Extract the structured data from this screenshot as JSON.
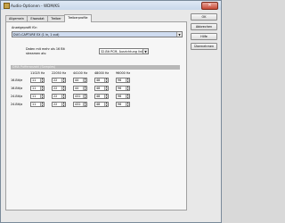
{
  "window": {
    "title": "Audio-Optionen - WDM/KS",
    "close_glyph": "✕"
  },
  "tabs": [
    {
      "label": "Allgemein",
      "active": false
    },
    {
      "label": "Eiwasdat",
      "active": false
    },
    {
      "label": "Treiber",
      "active": false
    },
    {
      "label": "Treiberprofile",
      "active": true
    }
  ],
  "buttons": {
    "ok": "OK",
    "cancel": "Abbrechen",
    "help": "Hilfe",
    "apply": "Übernehmen"
  },
  "profile": {
    "label": "Anzeigeprofil für:",
    "device": "DUO-CAPTURE EX (1 in, 1 out)"
  },
  "bits": {
    "label_line1": "Daten mit mehr als 16 Bit",
    "label_line2": "streamen als:",
    "value": "32-Bit PCM, Ausrichtung links"
  },
  "dma": {
    "header": "DMA Pufferanzahl (Samples)",
    "frequencies": [
      "11025 Hz",
      "22050 Hz",
      "44100 Hz",
      "48000 Hz",
      "96000 Hz"
    ],
    "rows": [
      {
        "label": "16-Bit/e",
        "values": [
          "11",
          "22",
          "44",
          "48",
          "96"
        ]
      },
      {
        "label": "16-Bit/a",
        "values": [
          "11",
          "22",
          "44",
          "48",
          "96"
        ]
      },
      {
        "label": "24-Bit/a",
        "values": [
          "11",
          "22",
          "432",
          "48",
          "96"
        ]
      },
      {
        "label": "24-Bit/a",
        "values": [
          "11",
          "22",
          "432",
          "48",
          "96"
        ]
      }
    ]
  }
}
